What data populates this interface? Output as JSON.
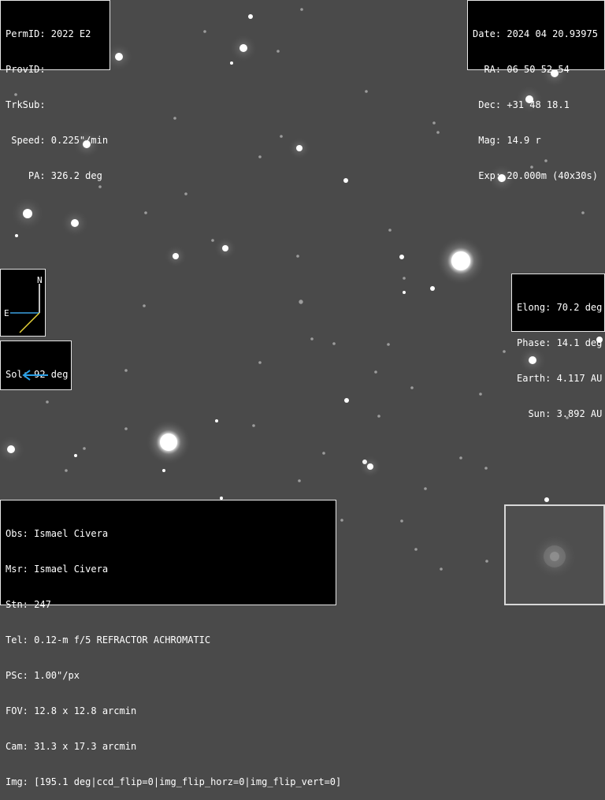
{
  "top_left": {
    "lines": [
      "PermID: 2022 E2",
      "ProvID:",
      "TrkSub:",
      " Speed: 0.225\"/min",
      "    PA: 326.2 deg"
    ]
  },
  "top_right": {
    "lines": [
      "Date: 2024 04 20.93975",
      "  RA: 06 50 52.54",
      " Dec: +31 48 18.1",
      " Mag: 14.9 r",
      " Exp: 20.000m (40x30s)"
    ]
  },
  "right_mid": {
    "lines": [
      "Elong: 70.2 deg",
      "Phase: 14.1 deg",
      "Earth: 4.117 AU",
      "  Sun: 3.892 AU"
    ]
  },
  "compass": {
    "north": "N",
    "east": "E",
    "north_color": "#ffffff",
    "east_color": "#3aa0e0",
    "motion_color": "#e8d43a"
  },
  "sol": {
    "label": "Sol: 92 deg",
    "arrow_color": "#2aa0e8"
  },
  "bottom_left": {
    "lines": [
      "Obs: Ismael Civera",
      "Msr: Ismael Civera",
      "Stn: 247",
      "Tel: 0.12-m f/5 REFRACTOR ACHROMATIC",
      "PSc: 1.00\"/px",
      "FOV: 12.8 x 12.8 arcmin",
      "Cam: 31.3 x 17.3 arcmin",
      "Img: [195.1 deg|ccd_flip=0|img_flip_horz=0|img_flip_vert=0]"
    ]
  },
  "colors": {
    "sky": "#4a4a4a",
    "panel_bg": "#000000",
    "panel_text": "#ffffff"
  }
}
